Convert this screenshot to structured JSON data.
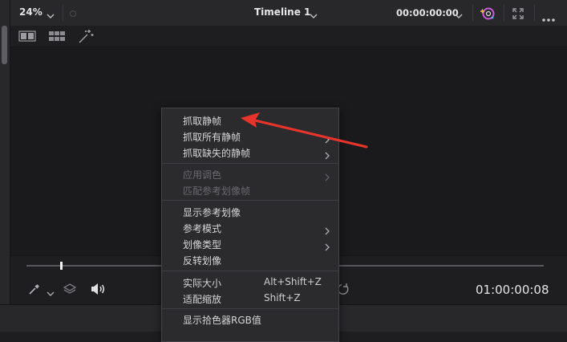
{
  "topbar": {
    "zoom": "24%",
    "timeline_title": "Timeline 1",
    "timecode": "00:00:00:00"
  },
  "transport": {
    "end_timecode": "01:00:00:08"
  },
  "menu": {
    "items": [
      {
        "label": "抓取静帧",
        "submenu": false,
        "disabled": false
      },
      {
        "label": "抓取所有静帧",
        "submenu": true,
        "disabled": false
      },
      {
        "label": "抓取缺失的静帧",
        "submenu": true,
        "disabled": false
      },
      {
        "label": "应用调色",
        "submenu": true,
        "disabled": true
      },
      {
        "label": "匹配参考划像帧",
        "submenu": false,
        "disabled": true
      },
      {
        "label": "显示参考划像",
        "submenu": false,
        "disabled": false
      },
      {
        "label": "参考模式",
        "submenu": true,
        "disabled": false
      },
      {
        "label": "划像类型",
        "submenu": true,
        "disabled": false
      },
      {
        "label": "反转划像",
        "submenu": false,
        "disabled": false
      },
      {
        "label": "实际大小",
        "shortcut": "Alt+Shift+Z",
        "disabled": false
      },
      {
        "label": "适配缩放",
        "shortcut": "Shift+Z",
        "disabled": false
      },
      {
        "label": "显示拾色器RGB值",
        "submenu": false,
        "disabled": false
      }
    ]
  },
  "colors": {
    "annotation": "#e8342a",
    "menu_bg": "#2b2b2e",
    "panel_bg": "#1e1e20"
  },
  "icons": [
    "chevron-down-icon",
    "color-fx-icon",
    "fullscreen-icon",
    "more-icon",
    "split-view-icon",
    "grid-view-icon",
    "magic-wand-icon",
    "eyedropper-icon",
    "layers-icon",
    "speaker-icon",
    "loop-icon",
    "submenu-arrow-icon"
  ]
}
